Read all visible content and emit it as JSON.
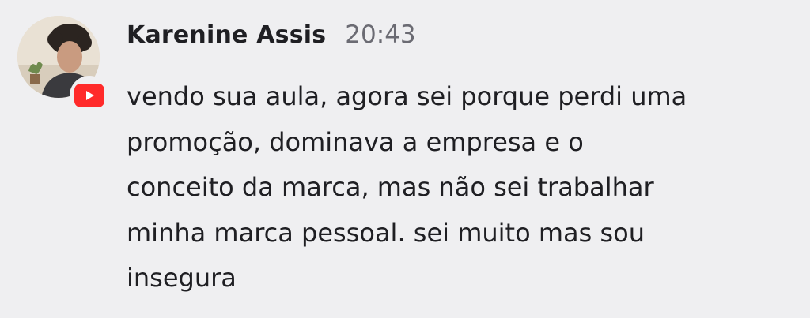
{
  "message": {
    "author": "Karenine Assis",
    "timestamp": "20:43",
    "lines": [
      "vendo sua aula, agora sei porque perdi uma",
      "promoção, dominava a empresa e o",
      "conceito da marca, mas não sei trabalhar",
      "minha marca pessoal. sei muito mas sou",
      "insegura"
    ],
    "badge_icon": "youtube-icon",
    "avatar_icon": "user-photo"
  },
  "colors": {
    "background": "#efeff1",
    "text": "#1f1f23",
    "timestamp": "#6b6b73",
    "badge": "#ff2a2a"
  }
}
